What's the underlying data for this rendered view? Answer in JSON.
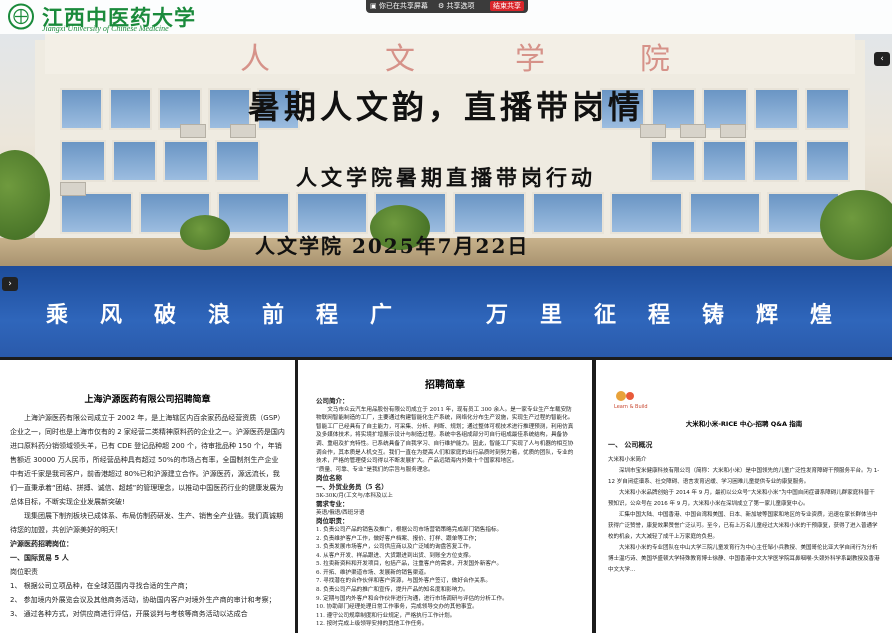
{
  "header": {
    "uni_name": "江西中医药大学",
    "uni_en": "Jiangxi University of Chinese Medicine",
    "share_status": "你已在共享屏幕",
    "share_options": "共享选项",
    "stop_share": "结束共享"
  },
  "slide": {
    "sign_chars": [
      "人",
      "文",
      "学",
      "院"
    ],
    "title": "暑期人文韵，直播带岗情",
    "subtitle": "人文学院暑期直播带岗行动",
    "date_line": "人文学院  2025年7月22日",
    "slogan_left": "乘风破浪前程广",
    "slogan_right": "万里征程铸辉煌"
  },
  "panel1": {
    "title": "上海沪源医药有限公司招聘简章",
    "paras": [
      "上海沪源医药有限公司成立于 2002 年，是上海辖区内百余家药品经营资质（GSP）企业之一，同时也是上海市仅有的 2 家经营二类精神原料药的企业之一。沪源医药是国内进口原料药分销领域领头羊，已有 CDE 登记品种超 200 个，待审批品种 150 个，年销售额近 30000 万人民币，所经营品种具有超过 50%的市场占有率，全国制剂生产企业中有近千家是我司客户，前香港超过 80%已和沪源建立合作。沪源医药，源远流长，我们一直秉承着“团结、拼搏、诚信、超越”的管理理念，以推动中国医药行业的健康发展为总体目标，不断实现企业发展新突破!",
      "现集团展下制剂板块已成体系、布局仿制药研发、生产、销售全产业链。我们真诚期待您的加盟，共创沪源美好的明天！"
    ],
    "section": "沪源医药招聘岗位：",
    "job": "一、国际贸易 5 人",
    "duty": "岗位职责",
    "items": [
      "1、  根据公司立项品种，在全球范围内寻找合适的生产商；",
      "2、  参加境内外展览会议及其他商务活动，协助国内客户对境外生产商的审计和考察；",
      "3、  通过各种方式，对供应商进行评估，开展谈判与考核等商务活动以达成合"
    ]
  },
  "panel2": {
    "title": "招聘简章",
    "intro_head": "公司简介：",
    "intro": "文马市众云汽车用品股份有限公司成立于 2011 年，现有员工 300 余人。是一家专业生产车载安防物联网智能制造的工厂，主要通过构建智能化生产系统，网络化分布生产设施，实现生产过程的智能化。智能工厂已经具有了自主能力，可采集、分析、判断、规划；通过整体可视技术进行推理预测，利用仿真及多媒体技术，将实境扩增展示设计与制造过程。系统中各组成部分可自行组成最佳系统结构，具备协调、重组及扩充特性。已系统具备了自我学习、自行维护能力。因此，智能工厂实现了人与机器的相互协调合作，其本质是人机交互。我们一直在为提高人们和家庭的出行品质时刻努力着，优质的团队，专业的技术，严格的管理使公司得以不断发展扩大。产品远销海内外数十个国家和地区。",
    "values": "“质量、可靠、专业”是我们的宗旨与服务理念。",
    "jobs_head": "岗位名称",
    "job1": "一、外贸业务员（5 名）",
    "salary": "5K-30K/月(工文与/本科及以上",
    "req_head": "需求专业：",
    "majors": "英语/俄语/西班牙语",
    "duty_head": "岗位职责：",
    "duties": [
      "1. 负责公司产品的销售及推广，根据公司市场营销策略完成部门销售指标。",
      "2. 负责维护客户工作，做好客户档案、报价、打样、跟单等工作；",
      "3. 负责发展市场客户，公司供应商以及广泛域的询盘答复工作，",
      "4. 从客户开发、样品跟进、大货跟进到出货、到账全方位支撑。",
      "5. 拉卖新资料和开发项目，包括产品，注重客户的需求，开发国外新客户。",
      "6. 开拓、维护渠道市场、发展新的销售渠道。",
      "7. 寻找潜在的合作伙伴和客户资源，与国外客户签订，做好合作关系。",
      "8. 负责公司产品的推广和宣传，提升产品的知名度和影响力。",
      "9. 定期与国内外客户和合作伙伴进行沟通，进行市场调研与评估的分析工作。",
      "10. 协助部门经理处理日常工作事务，完成领导交办的其他事宜。",
      "11. 遵守公司规章制度和行业规定，严格执行工作计划。",
      "12. 按时完成上级领导安排的其他工作任务。"
    ]
  },
  "panel3": {
    "brand": "Learn & Build",
    "title": "大米和小米-RICE 中心-招聘 Q&A 指南",
    "section": "一、  公司概况",
    "sub": "大米和小米简介",
    "paras": [
      "深圳市宝米健康科技有限公司（简称：大米和小米）是中国领先的儿童广泛性发育障碍干预服务平台。为 1-12 岁自闭症谱系、社交障碍、语言发育迟缓、学习困难儿童提供专业的康复服务。",
      "大米和小米品牌创始于 2014 年 9 月，最初以公众号“大米和小米”为中国自闭症谱系障碍儿群家庭科普干预知识，公众号在 2016 年 9 月，大米和小米在深圳成立了第一家儿童康复中心。",
      "汇集中国大陆、中国香港、中国台湾和美国、日本、新加坡等国家和地区的专业资质，迅速在家长群体当中获得广泛赞誉，康复效果赞誉广泛认可。至今，已有上万名儿童经过大米和小米的干预康复，获得了进入普通学校的机会，大大减轻了成千上万家庭的负担。",
      "大米和小米的专业团队在中山大学三院儿童发育行为中心主任邹小兵教授、美国哥伦比亚大学自闭行为分析博士温巧诗、美国华盛顿大学特殊教育博士徐静、中国香港中文大学医学院耳鼻咽喉-头颈外科学系副教授及香港中文大学..."
    ]
  }
}
